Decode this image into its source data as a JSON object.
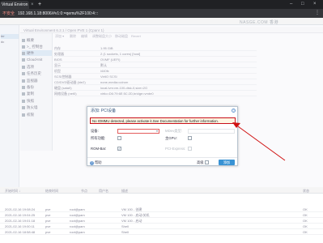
{
  "browser": {
    "tab_title": "Virtual Environ",
    "tab_close": "×",
    "new_tab": "+",
    "insecure_label": "不安全",
    "url": "192.168.1.18:8006/#v1:0:=qemu%2F100:4:::",
    "menu": "⋮",
    "window_controls": [
      "–",
      "□",
      "×"
    ]
  },
  "header": {
    "brand": "NASGE.COM 香港"
  },
  "sidebar": {
    "items": [
      "",
      "ter",
      "dc",
      "",
      "",
      "",
      ""
    ]
  },
  "breadcrumb": "Virtual Environment 6.2.1 / Open PVE 1 (Cpanr 1)",
  "toolbar": [
    "添加 ▾",
    "删除",
    "编辑",
    "调整磁盘大小",
    "移动磁盘",
    "Revert"
  ],
  "config_menu": [
    {
      "label": "概要",
      "selected": false
    },
    {
      "label": ">_ 控制台",
      "selected": false
    },
    {
      "label": "硬件",
      "selected": true
    },
    {
      "label": "Cloud-Init",
      "selected": false
    },
    {
      "label": "选项",
      "selected": false
    },
    {
      "label": "任务历史",
      "selected": false
    },
    {
      "label": "监视器",
      "selected": false
    },
    {
      "label": "备份",
      "selected": false
    },
    {
      "label": "复制",
      "selected": false
    },
    {
      "label": "快照",
      "selected": false
    },
    {
      "label": "防火墙",
      "selected": false
    },
    {
      "label": "权限",
      "selected": false
    }
  ],
  "hardware_rows": [
    {
      "k": "内存",
      "v": "1.95 GiB"
    },
    {
      "k": "处理器",
      "v": "2 (1 sockets, 1 cores) [host]"
    },
    {
      "k": "BIOS",
      "v": "OVMF (UEFI)"
    },
    {
      "k": "显示",
      "v": "默认"
    },
    {
      "k": "机型",
      "v": "i440fx"
    },
    {
      "k": "SCSI控制器",
      "v": "VirtIO SCSI"
    },
    {
      "k": "CD/DVD驱动器 (ide2)",
      "v": "none,media=cdrom"
    },
    {
      "k": "硬盘 (sata0)",
      "v": "local-lvm:vm-100-disk-0,size=2G"
    },
    {
      "k": "网络设备 (net0)",
      "v": "virtio=D6:79:6E:5C:2D,bridge=vmbr0"
    }
  ],
  "dialog": {
    "title": "添加: PCI设备",
    "help_icon": "?",
    "warning": "No IOMMU detected, please activate it.See Documentation for further information.",
    "fields": {
      "device_label": "设备:",
      "device_value": "",
      "mdev_label": "MDev类型:",
      "all_functions_label": "所有功能:",
      "primary_gpu_label": "主GPU:",
      "rom_bar_label": "ROM-Bar:",
      "rom_bar_checked": "✓",
      "pcie_label": "PCI-Express:",
      "pcie_checked": ""
    },
    "help_button": "帮助",
    "advanced_label": "高级",
    "add_button": "添加"
  },
  "log": {
    "headers": [
      "开始时间 ↓",
      "结束时间",
      "节点",
      "用户名",
      "描述",
      "状态"
    ],
    "rows": [
      {
        "start": "2021-02-16 19:08:24",
        "end": "",
        "node": "pve",
        "user": "root@pam",
        "desc": "VM 100 - 创建",
        "status": "OK"
      },
      {
        "start": "2021-02-16 19:04:25",
        "end": "",
        "node": "pve",
        "user": "root@pam",
        "desc": "VM 100 - 启动/关机",
        "status": "OK"
      },
      {
        "start": "2021-02-16 19:01:18",
        "end": "",
        "node": "pve",
        "user": "root@pam",
        "desc": "VM 100 - 启动",
        "status": "OK"
      },
      {
        "start": "2021-02-16 19:00:11",
        "end": "",
        "node": "pve",
        "user": "root@pam",
        "desc": "Shell",
        "status": "OK"
      },
      {
        "start": "2021-02-16 18:58:48",
        "end": "",
        "node": "pve",
        "user": "root@pam",
        "desc": "Shell",
        "status": "OK"
      }
    ]
  },
  "colors": {
    "accent": "#3892d4",
    "warning_border": "#c8101a",
    "annotation_arrow": "#d01010"
  }
}
